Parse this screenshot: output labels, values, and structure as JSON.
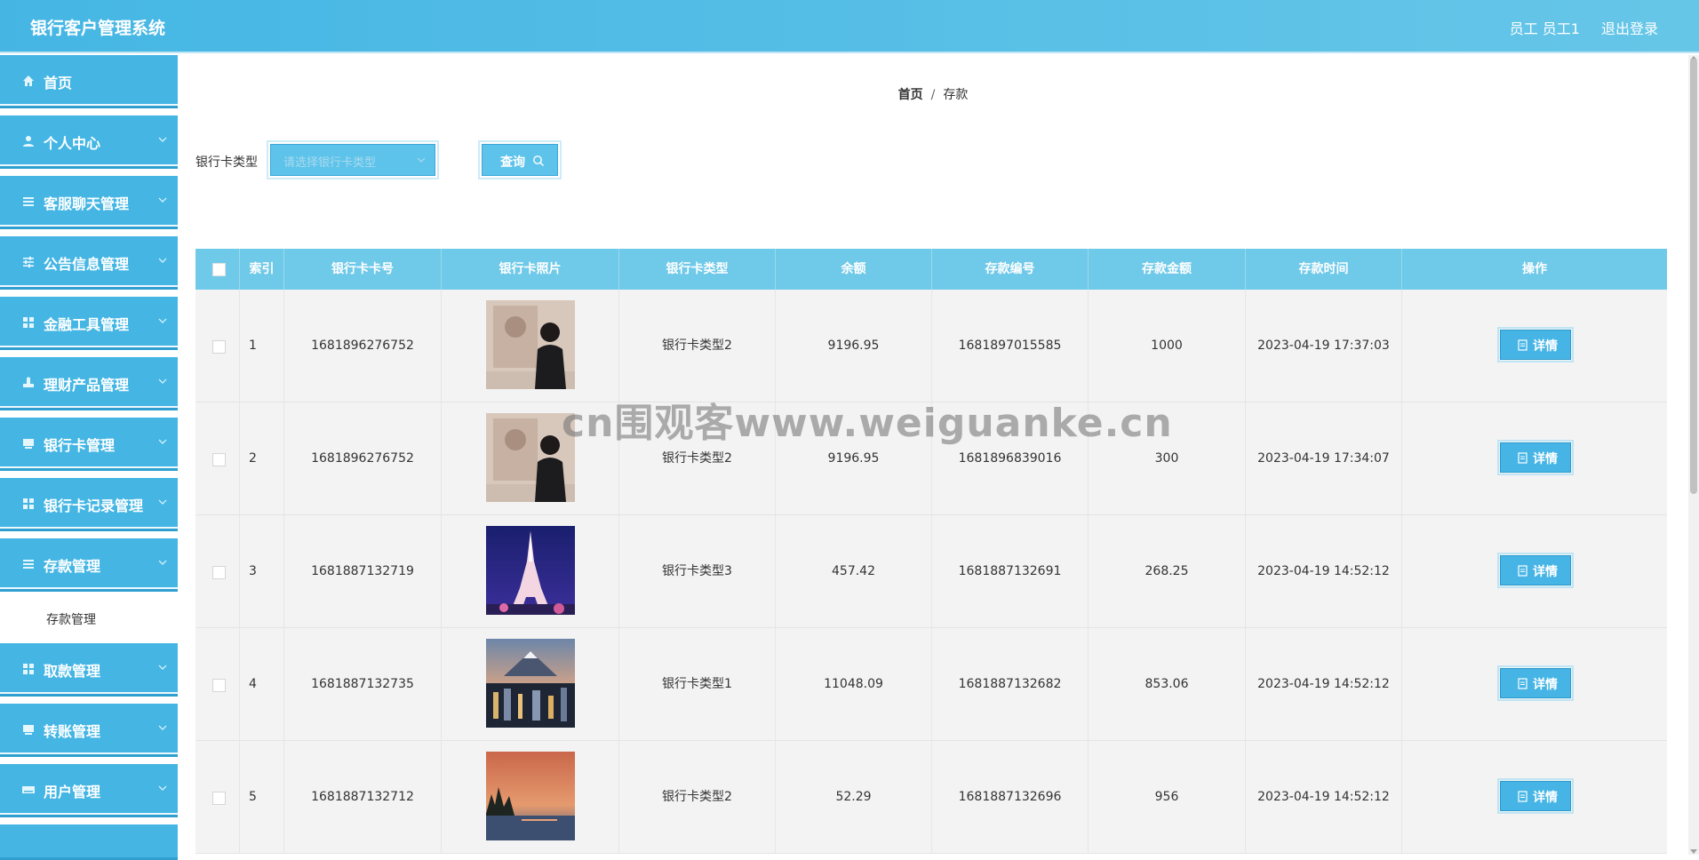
{
  "header": {
    "title": "银行客户管理系统",
    "user": "员工 员工1",
    "logout": "退出登录",
    "color": "#45b6e4"
  },
  "sidebar": {
    "items": [
      {
        "label": "首页",
        "icon": "home-icon",
        "has_arrow": false
      },
      {
        "label": "个人中心",
        "icon": "user-icon",
        "has_arrow": true
      },
      {
        "label": "客服聊天管理",
        "icon": "list-icon",
        "has_arrow": true
      },
      {
        "label": "公告信息管理",
        "icon": "sliders-icon",
        "has_arrow": true
      },
      {
        "label": "金融工具管理",
        "icon": "grid-icon",
        "has_arrow": true
      },
      {
        "label": "理财产品管理",
        "icon": "stamp-icon",
        "has_arrow": true
      },
      {
        "label": "银行卡管理",
        "icon": "card-icon",
        "has_arrow": true
      },
      {
        "label": "银行卡记录管理",
        "icon": "grid-icon",
        "has_arrow": true
      },
      {
        "label": "存款管理",
        "icon": "list-icon",
        "has_arrow": true
      },
      {
        "label": "取款管理",
        "icon": "grid-icon",
        "has_arrow": true
      },
      {
        "label": "转账管理",
        "icon": "card-icon",
        "has_arrow": true
      },
      {
        "label": "用户管理",
        "icon": "keyboard-icon",
        "has_arrow": true
      }
    ],
    "active_submenu": "存款管理"
  },
  "breadcrumb": {
    "home": "首页",
    "separator": "/",
    "current": "存款"
  },
  "filter": {
    "label": "银行卡类型",
    "placeholder": "请选择银行卡类型",
    "query_button": "查询"
  },
  "table": {
    "columns": [
      "索引",
      "银行卡卡号",
      "银行卡照片",
      "银行卡类型",
      "余额",
      "存款编号",
      "存款金额",
      "存款时间",
      "操作"
    ],
    "detail_label": "详情",
    "rows": [
      {
        "index": "1",
        "card_no": "1681896276752",
        "photo": "photo-person-art",
        "card_type": "银行卡类型2",
        "balance": "9196.95",
        "deposit_no": "1681897015585",
        "amount": "1000",
        "time": "2023-04-19 17:37:03"
      },
      {
        "index": "2",
        "card_no": "1681896276752",
        "photo": "photo-person-art",
        "card_type": "银行卡类型2",
        "balance": "9196.95",
        "deposit_no": "1681896839016",
        "amount": "300",
        "time": "2023-04-19 17:34:07"
      },
      {
        "index": "3",
        "card_no": "1681887132719",
        "photo": "photo-eiffel-tower",
        "card_type": "银行卡类型3",
        "balance": "457.42",
        "deposit_no": "1681887132691",
        "amount": "268.25",
        "time": "2023-04-19 14:52:12"
      },
      {
        "index": "4",
        "card_no": "1681887132735",
        "photo": "photo-city-mountain",
        "card_type": "银行卡类型1",
        "balance": "11048.09",
        "deposit_no": "1681887132682",
        "amount": "853.06",
        "time": "2023-04-19 14:52:12"
      },
      {
        "index": "5",
        "card_no": "1681887132712",
        "photo": "photo-sunset-lake",
        "card_type": "银行卡类型2",
        "balance": "52.29",
        "deposit_no": "1681887132696",
        "amount": "956",
        "time": "2023-04-19 14:52:12"
      }
    ]
  },
  "watermark": "cn围观客www.weiguanke.cn"
}
